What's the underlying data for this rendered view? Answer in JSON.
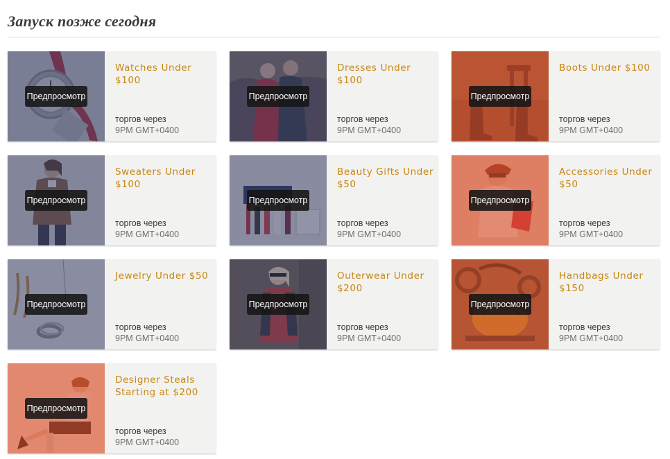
{
  "section": {
    "title": "Запуск позже сегодня"
  },
  "colors": {
    "title_accent": "#c98612",
    "overlay_navy": "#3c4264",
    "overlay_orange": "#d8512e",
    "card_bg": "#f2f2f0"
  },
  "cards": [
    {
      "title": "Watches Under $100",
      "preview_label": "Предпросмотр",
      "when": "торгов через",
      "time": "9PM GMT+0400",
      "image": "watch-photo",
      "overlay": "navy"
    },
    {
      "title": "Dresses Under $100",
      "preview_label": "Предпросмотр",
      "when": "торгов через",
      "time": "9PM GMT+0400",
      "image": "couple-photo",
      "overlay": "navy"
    },
    {
      "title": "Boots Under $100",
      "preview_label": "Предпросмотр",
      "when": "торгов через",
      "time": "9PM GMT+0400",
      "image": "boots-photo",
      "overlay": "orange"
    },
    {
      "title": "Sweaters Under $100",
      "preview_label": "Предпросмотр",
      "when": "торгов через",
      "time": "9PM GMT+0400",
      "image": "model-sweater-photo",
      "overlay": "navy"
    },
    {
      "title": "Beauty Gifts Under $50",
      "preview_label": "Предпросмотр",
      "when": "торгов через",
      "time": "9PM GMT+0400",
      "image": "cosmetics-photo",
      "overlay": "navy"
    },
    {
      "title": "Accessories Under $50",
      "preview_label": "Предпросмотр",
      "when": "торгов через",
      "time": "9PM GMT+0400",
      "image": "model-accessories-photo",
      "overlay": "orange"
    },
    {
      "title": "Jewelry Under $50",
      "preview_label": "Предпросмотр",
      "when": "торгов через",
      "time": "9PM GMT+0400",
      "image": "jewelry-photo",
      "overlay": "navy"
    },
    {
      "title": "Outerwear Under $200",
      "preview_label": "Предпросмотр",
      "when": "торгов через",
      "time": "9PM GMT+0400",
      "image": "outerwear-photo",
      "overlay": "navy"
    },
    {
      "title": "Handbags Under $150",
      "preview_label": "Предпросмотр",
      "when": "торгов через",
      "time": "9PM GMT+0400",
      "image": "handbag-photo",
      "overlay": "orange"
    },
    {
      "title": "Designer Steals Starting at $200",
      "preview_label": "Предпросмотр",
      "when": "торгов через",
      "time": "9PM GMT+0400",
      "image": "model-seated-photo",
      "overlay": "orange"
    }
  ]
}
